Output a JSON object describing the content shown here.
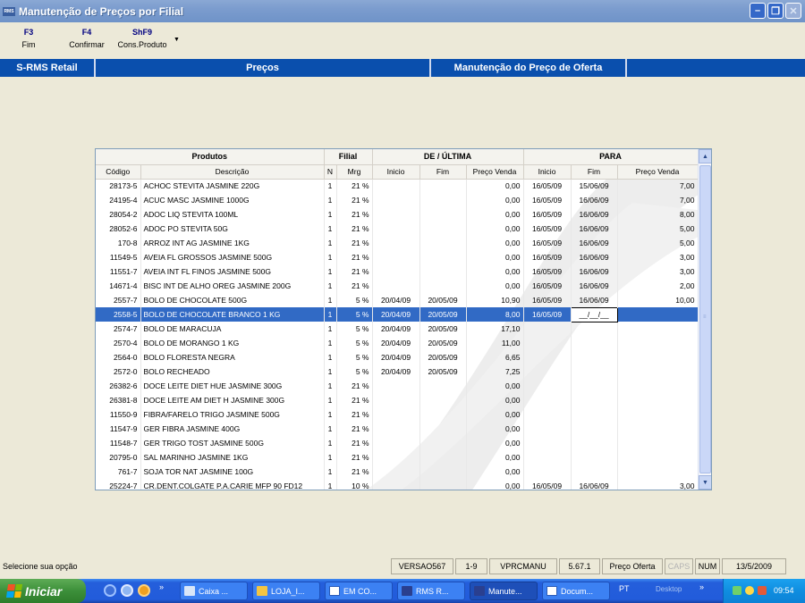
{
  "window": {
    "icon_text": "RMS",
    "title": "Manutenção de Preços por Filial"
  },
  "toolbar": {
    "items": [
      {
        "key": "F3",
        "label": "Fim"
      },
      {
        "key": "F4",
        "label": "Confirmar"
      },
      {
        "key": "ShF9",
        "label": "Cons.Produto"
      }
    ]
  },
  "header_band": {
    "app": "S-RMS Retail",
    "module": "Preços",
    "screen": "Manutenção do Preço de Oferta"
  },
  "grid": {
    "groups": [
      "Produtos",
      "Filial",
      "DE / ÚLTIMA",
      "PARA"
    ],
    "columns": [
      "Código",
      "Descrição",
      "N",
      "Mrg",
      "Inicio",
      "Fim",
      "Preço Venda",
      "Inicio",
      "Fim",
      "Preço Venda"
    ],
    "selected_row": 9,
    "rows": [
      [
        "28173-5",
        "ACHOC STEVITA JASMINE 220G",
        "1",
        "21 %",
        "",
        "",
        "0,00",
        "16/05/09",
        "15/06/09",
        "7,00"
      ],
      [
        "24195-4",
        "ACUC MASC JASMINE 1000G",
        "1",
        "21 %",
        "",
        "",
        "0,00",
        "16/05/09",
        "16/06/09",
        "7,00"
      ],
      [
        "28054-2",
        "ADOC LIQ STEVITA 100ML",
        "1",
        "21 %",
        "",
        "",
        "0,00",
        "16/05/09",
        "16/06/09",
        "8,00"
      ],
      [
        "28052-6",
        "ADOC PO STEVITA 50G",
        "1",
        "21 %",
        "",
        "",
        "0,00",
        "16/05/09",
        "16/06/09",
        "5,00"
      ],
      [
        "170-8",
        "ARROZ INT AG JASMINE 1KG",
        "1",
        "21 %",
        "",
        "",
        "0,00",
        "16/05/09",
        "16/06/09",
        "5,00"
      ],
      [
        "11549-5",
        "AVEIA FL GROSSOS JASMINE 500G",
        "1",
        "21 %",
        "",
        "",
        "0,00",
        "16/05/09",
        "16/06/09",
        "3,00"
      ],
      [
        "11551-7",
        "AVEIA INT FL FINOS JASMINE 500G",
        "1",
        "21 %",
        "",
        "",
        "0,00",
        "16/05/09",
        "16/06/09",
        "3,00"
      ],
      [
        "14671-4",
        "BISC INT DE ALHO OREG JASMINE 200G",
        "1",
        "21 %",
        "",
        "",
        "0,00",
        "16/05/09",
        "16/06/09",
        "2,00"
      ],
      [
        "2557-7",
        "BOLO DE CHOCOLATE 500G",
        "1",
        "5 %",
        "20/04/09",
        "20/05/09",
        "10,90",
        "16/05/09",
        "16/06/09",
        "10,00"
      ],
      [
        "2558-5",
        "BOLO DE CHOCOLATE BRANCO 1 KG",
        "1",
        "5 %",
        "20/04/09",
        "20/05/09",
        "8,00",
        "16/05/09",
        "__/__/__",
        ""
      ],
      [
        "2574-7",
        "BOLO DE MARACUJA",
        "1",
        "5 %",
        "20/04/09",
        "20/05/09",
        "17,10",
        "",
        "",
        ""
      ],
      [
        "2570-4",
        "BOLO DE MORANGO 1 KG",
        "1",
        "5 %",
        "20/04/09",
        "20/05/09",
        "11,00",
        "",
        "",
        ""
      ],
      [
        "2564-0",
        "BOLO FLORESTA NEGRA",
        "1",
        "5 %",
        "20/04/09",
        "20/05/09",
        "6,65",
        "",
        "",
        ""
      ],
      [
        "2572-0",
        "BOLO RECHEADO",
        "1",
        "5 %",
        "20/04/09",
        "20/05/09",
        "7,25",
        "",
        "",
        ""
      ],
      [
        "26382-6",
        "DOCE  LEITE DIET HUE JASMINE 300G",
        "1",
        "21 %",
        "",
        "",
        "0,00",
        "",
        "",
        ""
      ],
      [
        "26381-8",
        "DOCE LEITE AM DIET H JASMINE 300G",
        "1",
        "21 %",
        "",
        "",
        "0,00",
        "",
        "",
        ""
      ],
      [
        "11550-9",
        "FIBRA/FARELO TRIGO JASMINE 500G",
        "1",
        "21 %",
        "",
        "",
        "0,00",
        "",
        "",
        ""
      ],
      [
        "11547-9",
        "GER FIBRA JASMINE 400G",
        "1",
        "21 %",
        "",
        "",
        "0,00",
        "",
        "",
        ""
      ],
      [
        "11548-7",
        "GER TRIGO TOST JASMINE 500G",
        "1",
        "21 %",
        "",
        "",
        "0,00",
        "",
        "",
        ""
      ],
      [
        "20795-0",
        "SAL MARINHO JASMINE 1KG",
        "1",
        "21 %",
        "",
        "",
        "0,00",
        "",
        "",
        ""
      ],
      [
        "761-7",
        "SOJA TOR NAT JASMINE 100G",
        "1",
        "21 %",
        "",
        "",
        "0,00",
        "",
        "",
        ""
      ],
      [
        "25224-7",
        "CR.DENT.COLGATE P.A.CARIE MFP 90 FD12",
        "1",
        "10 %",
        "",
        "",
        "0,00",
        "16/05/09",
        "16/06/09",
        "3,00"
      ]
    ]
  },
  "statusbar": {
    "message": "Selecione sua opção",
    "panels": [
      "VERSAO567",
      "1-9",
      "VPRCMANU",
      "5.67.1",
      "Preço Oferta",
      "CAPS",
      "NUM",
      "13/5/2009"
    ]
  },
  "taskbar": {
    "start_label": "Iniciar",
    "tasks": [
      "Caixa ...",
      "LOJA_I...",
      "EM CO...",
      "RMS R...",
      "Manute...",
      "Docum..."
    ],
    "active_task": 4,
    "language": "PT",
    "desktop_label": "Desktop",
    "clock": "09:54"
  },
  "colors": {
    "band": "#0a4fad",
    "selection": "#316ac5",
    "titlebar": "#7b9cce"
  }
}
